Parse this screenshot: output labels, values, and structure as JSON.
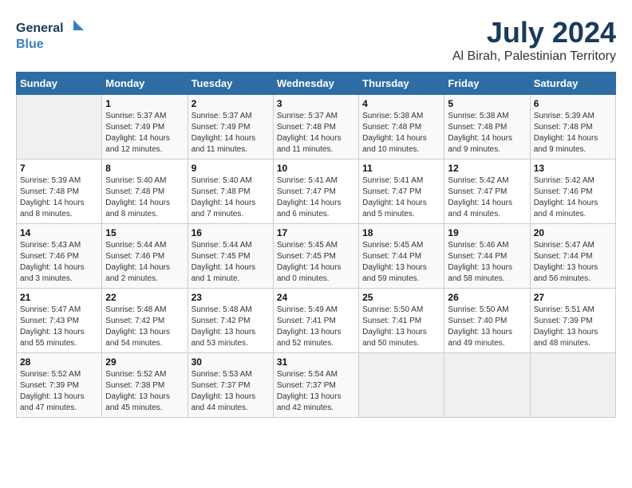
{
  "logo": {
    "line1": "General",
    "line2": "Blue"
  },
  "title": "July 2024",
  "subtitle": "Al Birah, Palestinian Territory",
  "days_header": [
    "Sunday",
    "Monday",
    "Tuesday",
    "Wednesday",
    "Thursday",
    "Friday",
    "Saturday"
  ],
  "weeks": [
    [
      {
        "num": "",
        "info": ""
      },
      {
        "num": "1",
        "info": "Sunrise: 5:37 AM\nSunset: 7:49 PM\nDaylight: 14 hours\nand 12 minutes."
      },
      {
        "num": "2",
        "info": "Sunrise: 5:37 AM\nSunset: 7:49 PM\nDaylight: 14 hours\nand 11 minutes."
      },
      {
        "num": "3",
        "info": "Sunrise: 5:37 AM\nSunset: 7:48 PM\nDaylight: 14 hours\nand 11 minutes."
      },
      {
        "num": "4",
        "info": "Sunrise: 5:38 AM\nSunset: 7:48 PM\nDaylight: 14 hours\nand 10 minutes."
      },
      {
        "num": "5",
        "info": "Sunrise: 5:38 AM\nSunset: 7:48 PM\nDaylight: 14 hours\nand 9 minutes."
      },
      {
        "num": "6",
        "info": "Sunrise: 5:39 AM\nSunset: 7:48 PM\nDaylight: 14 hours\nand 9 minutes."
      }
    ],
    [
      {
        "num": "7",
        "info": "Sunrise: 5:39 AM\nSunset: 7:48 PM\nDaylight: 14 hours\nand 8 minutes."
      },
      {
        "num": "8",
        "info": "Sunrise: 5:40 AM\nSunset: 7:48 PM\nDaylight: 14 hours\nand 8 minutes."
      },
      {
        "num": "9",
        "info": "Sunrise: 5:40 AM\nSunset: 7:48 PM\nDaylight: 14 hours\nand 7 minutes."
      },
      {
        "num": "10",
        "info": "Sunrise: 5:41 AM\nSunset: 7:47 PM\nDaylight: 14 hours\nand 6 minutes."
      },
      {
        "num": "11",
        "info": "Sunrise: 5:41 AM\nSunset: 7:47 PM\nDaylight: 14 hours\nand 5 minutes."
      },
      {
        "num": "12",
        "info": "Sunrise: 5:42 AM\nSunset: 7:47 PM\nDaylight: 14 hours\nand 4 minutes."
      },
      {
        "num": "13",
        "info": "Sunrise: 5:42 AM\nSunset: 7:46 PM\nDaylight: 14 hours\nand 4 minutes."
      }
    ],
    [
      {
        "num": "14",
        "info": "Sunrise: 5:43 AM\nSunset: 7:46 PM\nDaylight: 14 hours\nand 3 minutes."
      },
      {
        "num": "15",
        "info": "Sunrise: 5:44 AM\nSunset: 7:46 PM\nDaylight: 14 hours\nand 2 minutes."
      },
      {
        "num": "16",
        "info": "Sunrise: 5:44 AM\nSunset: 7:45 PM\nDaylight: 14 hours\nand 1 minute."
      },
      {
        "num": "17",
        "info": "Sunrise: 5:45 AM\nSunset: 7:45 PM\nDaylight: 14 hours\nand 0 minutes."
      },
      {
        "num": "18",
        "info": "Sunrise: 5:45 AM\nSunset: 7:44 PM\nDaylight: 13 hours\nand 59 minutes."
      },
      {
        "num": "19",
        "info": "Sunrise: 5:46 AM\nSunset: 7:44 PM\nDaylight: 13 hours\nand 58 minutes."
      },
      {
        "num": "20",
        "info": "Sunrise: 5:47 AM\nSunset: 7:44 PM\nDaylight: 13 hours\nand 56 minutes."
      }
    ],
    [
      {
        "num": "21",
        "info": "Sunrise: 5:47 AM\nSunset: 7:43 PM\nDaylight: 13 hours\nand 55 minutes."
      },
      {
        "num": "22",
        "info": "Sunrise: 5:48 AM\nSunset: 7:42 PM\nDaylight: 13 hours\nand 54 minutes."
      },
      {
        "num": "23",
        "info": "Sunrise: 5:48 AM\nSunset: 7:42 PM\nDaylight: 13 hours\nand 53 minutes."
      },
      {
        "num": "24",
        "info": "Sunrise: 5:49 AM\nSunset: 7:41 PM\nDaylight: 13 hours\nand 52 minutes."
      },
      {
        "num": "25",
        "info": "Sunrise: 5:50 AM\nSunset: 7:41 PM\nDaylight: 13 hours\nand 50 minutes."
      },
      {
        "num": "26",
        "info": "Sunrise: 5:50 AM\nSunset: 7:40 PM\nDaylight: 13 hours\nand 49 minutes."
      },
      {
        "num": "27",
        "info": "Sunrise: 5:51 AM\nSunset: 7:39 PM\nDaylight: 13 hours\nand 48 minutes."
      }
    ],
    [
      {
        "num": "28",
        "info": "Sunrise: 5:52 AM\nSunset: 7:39 PM\nDaylight: 13 hours\nand 47 minutes."
      },
      {
        "num": "29",
        "info": "Sunrise: 5:52 AM\nSunset: 7:38 PM\nDaylight: 13 hours\nand 45 minutes."
      },
      {
        "num": "30",
        "info": "Sunrise: 5:53 AM\nSunset: 7:37 PM\nDaylight: 13 hours\nand 44 minutes."
      },
      {
        "num": "31",
        "info": "Sunrise: 5:54 AM\nSunset: 7:37 PM\nDaylight: 13 hours\nand 42 minutes."
      },
      {
        "num": "",
        "info": ""
      },
      {
        "num": "",
        "info": ""
      },
      {
        "num": "",
        "info": ""
      }
    ]
  ]
}
